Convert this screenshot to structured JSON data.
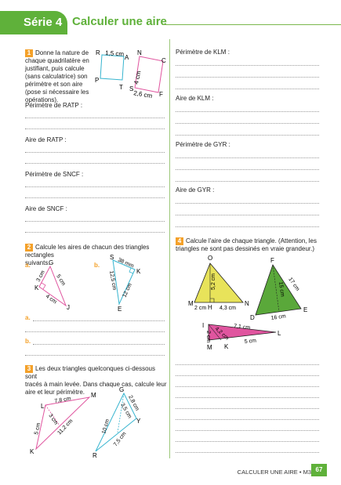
{
  "header": {
    "series": "Série 4",
    "title": "Calculer une aire"
  },
  "ex1": {
    "num": "1",
    "lines": [
      "Donne la nature de",
      "chaque quadrilatère en",
      "justifiant, puis calcule",
      "(sans calculatrice) son",
      "périmètre et son aire",
      "(pose si nécessaire les",
      "opérations)."
    ],
    "fig": {
      "R": "R",
      "A": "A",
      "P": "P",
      "T": "T",
      "N": "N",
      "C": "C",
      "S": "S",
      "F": "F",
      "d1": "1,5 cm",
      "d2": "4 cm",
      "d3": "2,6 cm"
    },
    "perim_ratp": "Périmètre de RATP :",
    "aire_ratp": "Aire de RATP :",
    "perim_sncf": "Périmètre de SNCF :",
    "aire_sncf": "Aire de SNCF :",
    "perim_klm": "Périmètre de KLM :",
    "aire_klm": "Aire de KLM :",
    "perim_gyr": "Périmètre de GYR :",
    "aire_gyr": "Aire de GYR :"
  },
  "ex2": {
    "num": "2",
    "lines": [
      "Calcule les aires de chacun des triangles rectangles",
      "suivants."
    ],
    "a": "a.",
    "b": "b.",
    "figA": {
      "G": "G",
      "K": "K",
      "J": "J",
      "d1": "3 cm",
      "d2": "5 cm",
      "d3": "4 cm"
    },
    "figB": {
      "S": "S",
      "K": "K",
      "E": "E",
      "d1": "38 mm",
      "d2": "12,5 cm",
      "d3": "12 cm"
    },
    "ans_a": "a.",
    "ans_b": "b."
  },
  "ex3": {
    "num": "3",
    "lines": [
      "Les deux triangles quelconques ci-dessous sont",
      "tracés à main levée. Dans chaque cas, calcule leur",
      "aire et leur périmètre."
    ],
    "fig1": {
      "L": "L",
      "M": "M",
      "K": "K",
      "d1": "7,8 cm",
      "d2": "3 cm",
      "d3": "11,2 cm",
      "d4": "5 cm"
    },
    "fig2": {
      "G": "G",
      "Y": "Y",
      "R": "R",
      "d1": "2,8 cm",
      "d2": "3,5 cm",
      "d3": "10 cm",
      "d4": "7,5 cm"
    }
  },
  "ex4": {
    "num": "4",
    "lines": [
      "Calcule l'aire de chaque triangle. (Attention, les",
      "triangles ne sont pas dessinés en vraie grandeur.)"
    ],
    "fig1": {
      "O": "O",
      "M": "M",
      "H": "H",
      "N": "N",
      "d1": "5,2 cm",
      "d2": "2 cm",
      "d3": "4,3 cm"
    },
    "fig2": {
      "F": "F",
      "D": "D",
      "E": "E",
      "d1": "17 cm",
      "d2": "15 cm",
      "d3": "16 cm"
    },
    "fig3": {
      "L": "L",
      "M": "M",
      "K": "K",
      "I": "I",
      "d1": "7,1 cm",
      "d2": "2 cm",
      "d3": "4,2 cm",
      "d4": "5 cm"
    }
  },
  "footer": {
    "text": "CALCULER UNE AIRE • M3",
    "page": "67"
  },
  "colors": {
    "green": "#5fb13a",
    "orange": "#f4a12a",
    "pink": "#e0559f",
    "cyan": "#36b4cf",
    "yellow": "#e8e35a",
    "dkgreen": "#5aa83a"
  }
}
